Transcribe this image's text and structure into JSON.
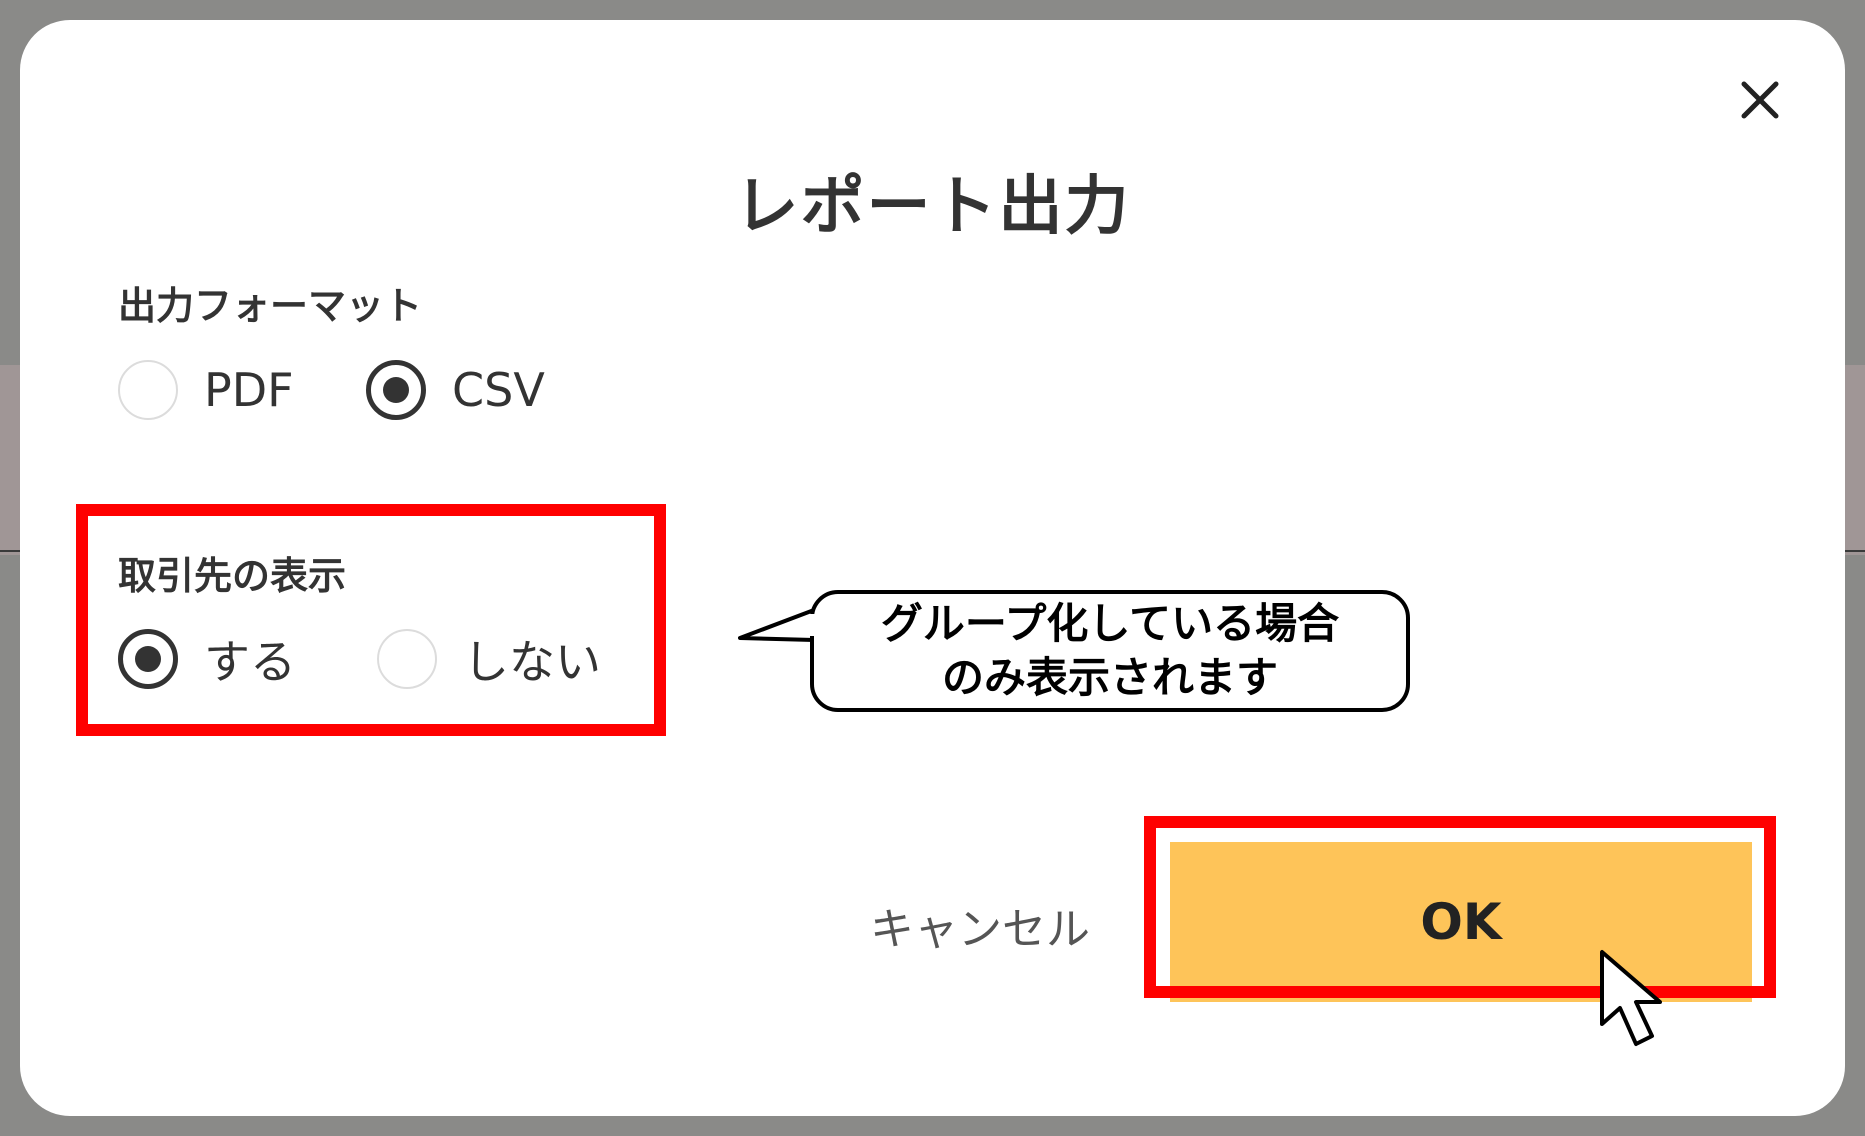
{
  "dialog": {
    "title": "レポート出力",
    "close_icon": "close-icon"
  },
  "output_format": {
    "label": "出力フォーマット",
    "options": [
      {
        "label": "PDF",
        "selected": false
      },
      {
        "label": "CSV",
        "selected": true
      }
    ]
  },
  "client_display": {
    "label": "取引先の表示",
    "options": [
      {
        "label": "する",
        "selected": true
      },
      {
        "label": "しない",
        "selected": false
      }
    ]
  },
  "callout": {
    "line1": "グループ化している場合",
    "line2": "のみ表示されます"
  },
  "buttons": {
    "cancel_label": "キャンセル",
    "ok_label": "OK"
  },
  "colors": {
    "ok_button": "#fec459",
    "highlight": "#ff0000",
    "backdrop": "#8a8a88"
  },
  "icons": {
    "cursor": "mouse-pointer-icon"
  }
}
